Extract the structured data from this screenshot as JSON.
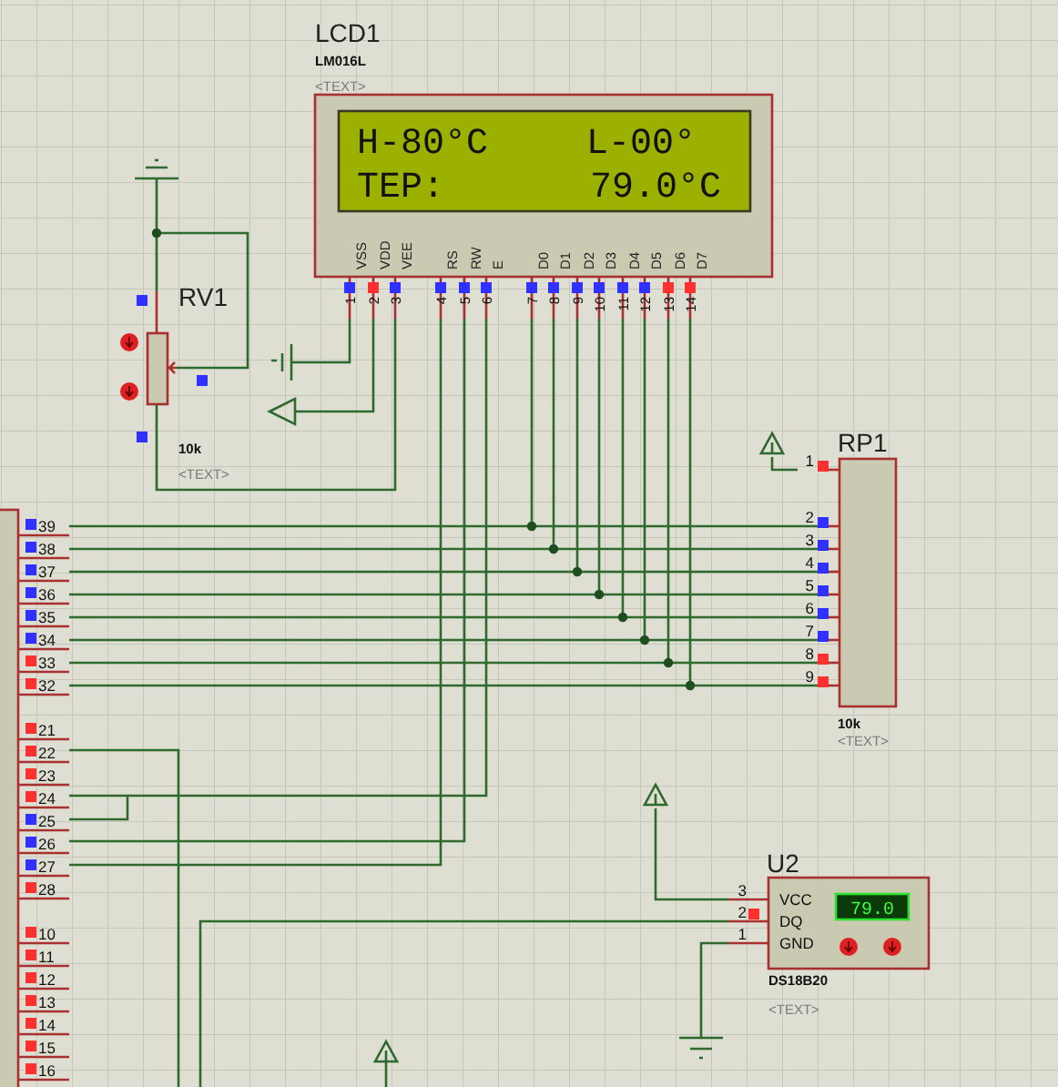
{
  "lcd": {
    "ref": "LCD1",
    "part": "LM016L",
    "tag": "<TEXT>",
    "display_rows": [
      [
        "H-80°C",
        "L-00°"
      ],
      [
        "TEP:",
        "79.0°C"
      ]
    ],
    "pins": [
      {
        "number": "1",
        "label": "VSS",
        "high": false
      },
      {
        "number": "2",
        "label": "VDD",
        "high": true
      },
      {
        "number": "3",
        "label": "VEE",
        "high": false
      },
      {
        "number": "4",
        "label": "RS",
        "high": false
      },
      {
        "number": "5",
        "label": "RW",
        "high": false
      },
      {
        "number": "6",
        "label": "E",
        "high": false
      },
      {
        "number": "7",
        "label": "D0",
        "high": false
      },
      {
        "number": "8",
        "label": "D1",
        "high": false
      },
      {
        "number": "9",
        "label": "D2",
        "high": false
      },
      {
        "number": "10",
        "label": "D3",
        "high": false
      },
      {
        "number": "11",
        "label": "D4",
        "high": false
      },
      {
        "number": "12",
        "label": "D5",
        "high": false
      },
      {
        "number": "13",
        "label": "D6",
        "high": true
      },
      {
        "number": "14",
        "label": "D7",
        "high": true
      }
    ]
  },
  "rv1": {
    "ref": "RV1",
    "value": "10k",
    "tag": "<TEXT>",
    "pins": [
      {
        "high": false
      },
      {
        "high": false
      },
      {
        "high": false
      }
    ]
  },
  "rp1": {
    "ref": "RP1",
    "value": "10k",
    "tag": "<TEXT>",
    "pins": [
      {
        "number": "1",
        "high": true
      },
      {
        "number": "2",
        "high": false
      },
      {
        "number": "3",
        "high": false
      },
      {
        "number": "4",
        "high": false
      },
      {
        "number": "5",
        "high": false
      },
      {
        "number": "6",
        "high": false
      },
      {
        "number": "7",
        "high": false
      },
      {
        "number": "8",
        "high": true
      },
      {
        "number": "9",
        "high": true
      }
    ]
  },
  "u2": {
    "ref": "U2",
    "part": "DS18B20",
    "tag": "<TEXT>",
    "readout": "79.0",
    "pins": [
      {
        "number": "3",
        "label": "VCC"
      },
      {
        "number": "2",
        "label": "DQ",
        "high": true
      },
      {
        "number": "1",
        "label": "GND"
      }
    ]
  },
  "mcu_pins": [
    {
      "number": "39",
      "high": false
    },
    {
      "number": "38",
      "high": false
    },
    {
      "number": "37",
      "high": false
    },
    {
      "number": "36",
      "high": false
    },
    {
      "number": "35",
      "high": false
    },
    {
      "number": "34",
      "high": false
    },
    {
      "number": "33",
      "high": true
    },
    {
      "number": "32",
      "high": true
    },
    {
      "number": "21",
      "high": true
    },
    {
      "number": "22",
      "high": true
    },
    {
      "number": "23",
      "high": true
    },
    {
      "number": "24",
      "high": true
    },
    {
      "number": "25",
      "high": false
    },
    {
      "number": "26",
      "high": false
    },
    {
      "number": "27",
      "high": false
    },
    {
      "number": "28",
      "high": true
    },
    {
      "number": "10",
      "high": true
    },
    {
      "number": "11",
      "high": true
    },
    {
      "number": "12",
      "high": true
    },
    {
      "number": "13",
      "high": true
    },
    {
      "number": "14",
      "high": true
    },
    {
      "number": "15",
      "high": true
    },
    {
      "number": "16",
      "high": true
    }
  ]
}
